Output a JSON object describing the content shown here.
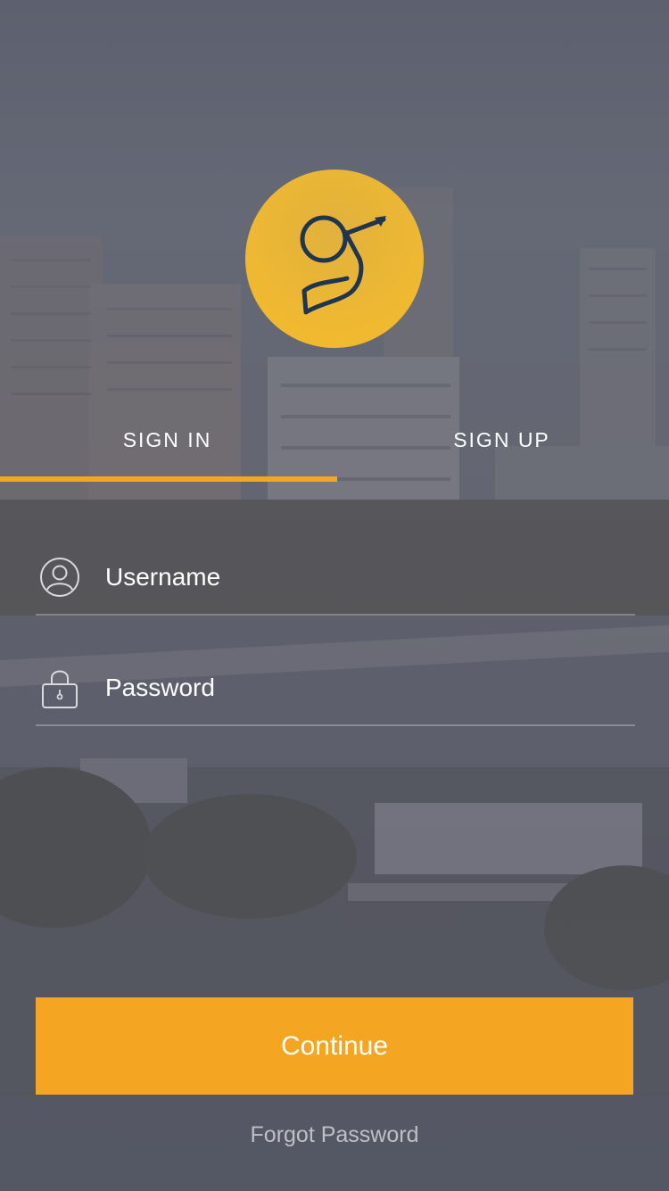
{
  "colors": {
    "accent": "#f4a623",
    "logo_gold": "#eeb832",
    "logo_mark": "#1f3550",
    "text": "#ffffff"
  },
  "logo": {
    "icon": "g-arrow-logo-icon"
  },
  "tabs": [
    {
      "label": "SIGN IN",
      "active": true
    },
    {
      "label": "SIGN UP",
      "active": false
    }
  ],
  "form": {
    "username": {
      "placeholder": "Username",
      "value": "",
      "icon": "user-circle-icon"
    },
    "password": {
      "placeholder": "Password",
      "value": "",
      "icon": "lock-icon"
    }
  },
  "actions": {
    "continue_label": "Continue",
    "forgot_label": "Forgot Password"
  }
}
